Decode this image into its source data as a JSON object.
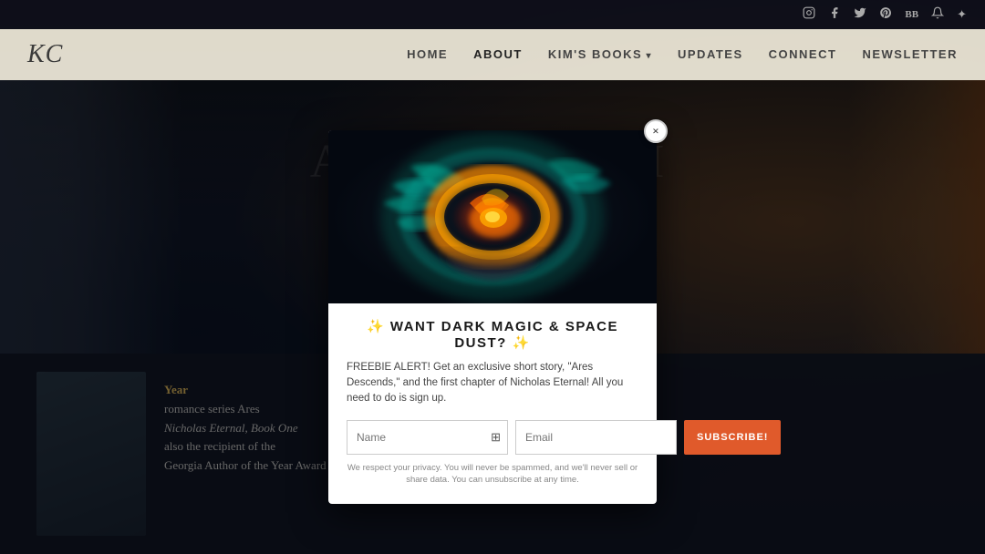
{
  "topBar": {
    "icons": [
      "instagram",
      "facebook",
      "twitter",
      "pinterest",
      "bb",
      "bell",
      "sparkle"
    ]
  },
  "nav": {
    "logo": "KC",
    "links": [
      {
        "label": "HOME",
        "active": false,
        "dropdown": false
      },
      {
        "label": "ABOUT",
        "active": true,
        "dropdown": false
      },
      {
        "label": "KIM'S BOOKS",
        "active": false,
        "dropdown": true
      },
      {
        "label": "UPDATES",
        "active": false,
        "dropdown": false
      },
      {
        "label": "CONNECT",
        "active": false,
        "dropdown": false
      },
      {
        "label": "NEWSLETTER",
        "active": false,
        "dropdown": false
      }
    ]
  },
  "pageTitle": "ABOUT KIM",
  "modal": {
    "closeLabel": "×",
    "headline": "✨ WANT DARK MAGIC & SPACE DUST? ✨",
    "description": "FREEBIE ALERT! Get an exclusive short story, \"Ares Descends,\" and the first chapter of Nicholas Eternal! All you need to do is sign up.",
    "namePlaceholder": "Name",
    "emailPlaceholder": "Email",
    "subscribeLabel": "SUBSCRIBE!",
    "privacy": "We respect your privacy. You will never be spammed, and we'll never sell or share data. You can\nunsubscribe at any time."
  },
  "authorSection": {
    "yearLabel": "Year",
    "text1": "romance series Ares",
    "text2": "Nicholas Eternal, Book One",
    "text3": "also the recipient of the",
    "text4": "Georgia Author of the Year Award for Romance."
  }
}
